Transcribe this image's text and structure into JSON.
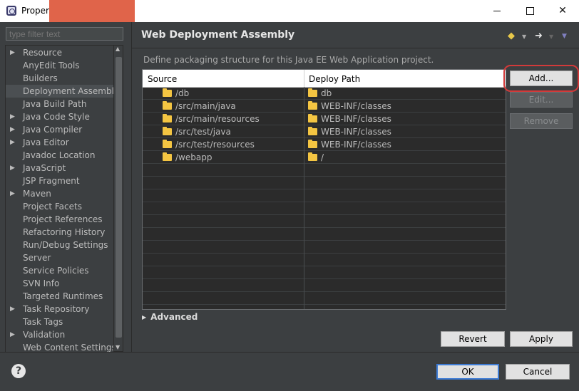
{
  "window": {
    "title": "Propert"
  },
  "filter": {
    "placeholder": "type filter text"
  },
  "sidebar": {
    "items": [
      {
        "label": "Resource",
        "expandable": true
      },
      {
        "label": "AnyEdit Tools",
        "expandable": false
      },
      {
        "label": "Builders",
        "expandable": false
      },
      {
        "label": "Deployment Assembly",
        "expandable": false,
        "selected": true
      },
      {
        "label": "Java Build Path",
        "expandable": false
      },
      {
        "label": "Java Code Style",
        "expandable": true
      },
      {
        "label": "Java Compiler",
        "expandable": true
      },
      {
        "label": "Java Editor",
        "expandable": true
      },
      {
        "label": "Javadoc Location",
        "expandable": false
      },
      {
        "label": "JavaScript",
        "expandable": true
      },
      {
        "label": "JSP Fragment",
        "expandable": false
      },
      {
        "label": "Maven",
        "expandable": true
      },
      {
        "label": "Project Facets",
        "expandable": false
      },
      {
        "label": "Project References",
        "expandable": false
      },
      {
        "label": "Refactoring History",
        "expandable": false
      },
      {
        "label": "Run/Debug Settings",
        "expandable": false
      },
      {
        "label": "Server",
        "expandable": false
      },
      {
        "label": "Service Policies",
        "expandable": false
      },
      {
        "label": "SVN Info",
        "expandable": false
      },
      {
        "label": "Targeted Runtimes",
        "expandable": false
      },
      {
        "label": "Task Repository",
        "expandable": true
      },
      {
        "label": "Task Tags",
        "expandable": false
      },
      {
        "label": "Validation",
        "expandable": true
      },
      {
        "label": "Web Content Settings",
        "expandable": false
      }
    ]
  },
  "page": {
    "title": "Web Deployment Assembly",
    "description": "Define packaging structure for this Java EE Web Application project."
  },
  "table": {
    "columns": [
      "Source",
      "Deploy Path"
    ],
    "rows": [
      {
        "source": "/db",
        "deploy": "db"
      },
      {
        "source": "/src/main/java",
        "deploy": "WEB-INF/classes"
      },
      {
        "source": "/src/main/resources",
        "deploy": "WEB-INF/classes"
      },
      {
        "source": "/src/test/java",
        "deploy": "WEB-INF/classes"
      },
      {
        "source": "/src/test/resources",
        "deploy": "WEB-INF/classes"
      },
      {
        "source": "/webapp",
        "deploy": "/"
      }
    ]
  },
  "buttons": {
    "add": "Add...",
    "edit": "Edit...",
    "remove": "Remove",
    "revert": "Revert",
    "apply": "Apply",
    "ok": "OK",
    "cancel": "Cancel"
  },
  "advanced": {
    "label": "Advanced"
  },
  "colors": {
    "accent_ring": "#d23a3a",
    "folder": "#f4c542",
    "ok_border": "#3d7bd4"
  }
}
